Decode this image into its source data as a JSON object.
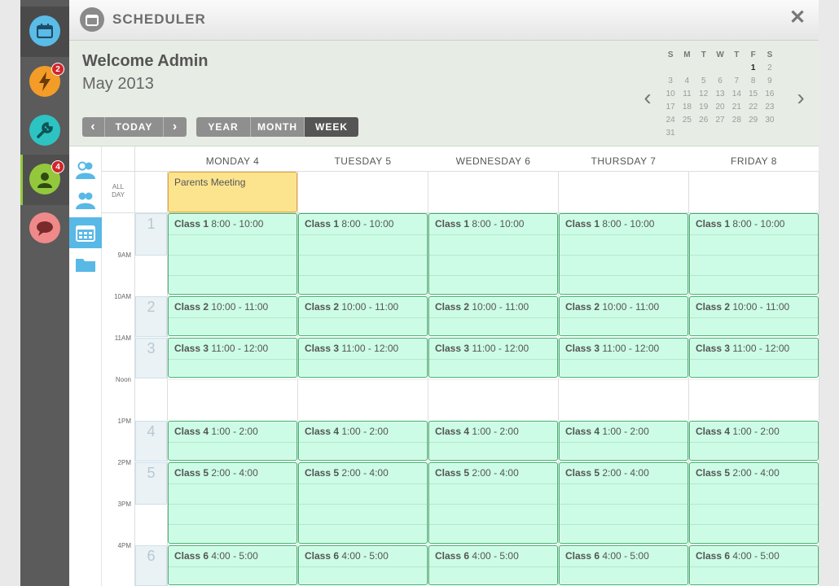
{
  "app": {
    "title": "SCHEDULER",
    "close": "✕"
  },
  "rail": {
    "items": [
      {
        "name": "calendar",
        "color": "#5bbce8",
        "badge": ""
      },
      {
        "name": "bolt",
        "color": "#f39c28",
        "badge": "2"
      },
      {
        "name": "wrench",
        "color": "#2ec3c3",
        "badge": ""
      },
      {
        "name": "user",
        "color": "#93c83d",
        "badge": "4"
      },
      {
        "name": "chat",
        "color": "#f08a8a",
        "badge": ""
      }
    ]
  },
  "header": {
    "welcome": "Welcome Admin",
    "month": "May 2013",
    "nav": {
      "prev": "‹",
      "today": "TODAY",
      "next": "›"
    },
    "views": {
      "year": "YEAR",
      "month": "MONTH",
      "week": "WEEK",
      "active": "WEEK"
    }
  },
  "mini_calendar": {
    "prev": "‹",
    "next": "›",
    "weekdays": [
      "S",
      "M",
      "T",
      "W",
      "T",
      "F",
      "S"
    ],
    "weeks": [
      [
        "",
        "",
        "",
        "",
        "",
        "1",
        "2"
      ],
      [
        "3",
        "4",
        "5",
        "6",
        "7",
        "8",
        "9"
      ],
      [
        "10",
        "11",
        "12",
        "13",
        "14",
        "15",
        "16"
      ],
      [
        "17",
        "18",
        "19",
        "20",
        "21",
        "22",
        "23"
      ],
      [
        "24",
        "25",
        "26",
        "27",
        "28",
        "29",
        "30"
      ],
      [
        "31",
        "",
        "",
        "",
        "",
        "",
        ""
      ]
    ],
    "today": "1"
  },
  "week": {
    "days": [
      "MONDAY 4",
      "TUESDAY 5",
      "WEDNESDAY 6",
      "THURSDAY 7",
      "FRIDAY 8"
    ],
    "all_day_label": [
      "ALL",
      "DAY"
    ],
    "all_day_event": "Parents Meeting",
    "time_labels": [
      "9AM",
      "10AM",
      "11AM",
      "Noon",
      "1PM",
      "2PM",
      "3PM",
      "4PM"
    ],
    "periods": [
      "1",
      "2",
      "3",
      "4",
      "5",
      "6"
    ],
    "classes": [
      {
        "name": "Class 1",
        "time": "8:00 - 10:00"
      },
      {
        "name": "Class 2",
        "time": "10:00 - 11:00"
      },
      {
        "name": "Class 3",
        "time": "11:00 - 12:00"
      },
      {
        "name": "Class 4",
        "time": "1:00 - 2:00"
      },
      {
        "name": "Class 5",
        "time": "2:00 - 4:00"
      },
      {
        "name": "Class 6",
        "time": "4:00 - 5:00"
      }
    ]
  }
}
